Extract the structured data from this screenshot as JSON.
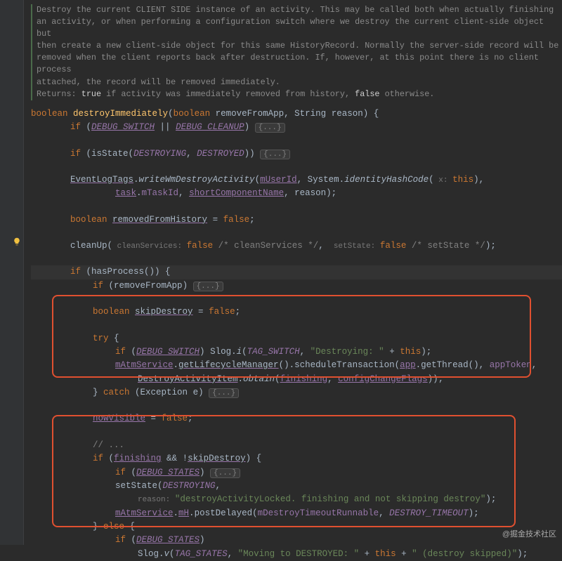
{
  "doc": {
    "l1": "Destroy the current CLIENT SIDE instance of an activity. This may be called both when actually finishing",
    "l2": "an activity, or when performing a configuration switch where we destroy the current client-side object but",
    "l3": "then create a new client-side object for this same HistoryRecord. Normally the server-side record will be",
    "l4": "removed when the client reports back after destruction. If, however, at this point there is no client process",
    "l5": "attached, the record will be removed immediately.",
    "ret_label": "Returns:",
    "ret_true": "true",
    "ret_mid": " if activity was immediately removed from history, ",
    "ret_false": "false",
    "ret_end": " otherwise."
  },
  "sig": {
    "kw_boolean": "boolean",
    "name": "destroyImmediately",
    "p1_type": "boolean",
    "p1_name": "removeFromApp",
    "p2_type": "String",
    "p2_name": "reason",
    "brace": " {"
  },
  "c": {
    "if": "if",
    "else": "else",
    "try": "try",
    "catch": "catch",
    "boolean": "boolean",
    "false": "false",
    "this": "this",
    "debug_switch": "DEBUG_SWITCH",
    "debug_cleanup": "DEBUG_CLEANUP",
    "debug_states": "DEBUG_STATES",
    "fold": "{...}",
    "isState": "isState",
    "destroying": "DESTROYING",
    "destroyed": "DESTROYED",
    "eventLogTags": "EventLogTags",
    "writeWm": "writeWmDestroyActivity",
    "mUserId": "mUserId",
    "System": "System",
    "idHash": "identityHashCode",
    "hint_x": " x: ",
    "task": "task",
    "mTaskId": "mTaskId",
    "shortComp": "shortComponentName",
    "reason": "reason",
    "removedFromHistory": "removedFromHistory",
    "cleanUp": "cleanUp",
    "hint_cleanServices": " cleanServices: ",
    "cm_cleanServices": " /* cleanServices */",
    "hint_setState": " setState: ",
    "cm_setState": " /* setState */",
    "hasProcess": "hasProcess",
    "removeFromApp": "removeFromApp",
    "skipDestroy": "skipDestroy",
    "Slog": "Slog",
    "slog_i": "i",
    "slog_v": "v",
    "tag_switch": "TAG_SWITCH",
    "tag_states": "TAG_STATES",
    "str_destroying": "\"Destroying: \"",
    "plus": " + ",
    "mAtmService": "mAtmService",
    "getLCM": "getLifecycleManager",
    "schedTx": "scheduleTransaction",
    "app": "app",
    "getThread": "getThread",
    "appToken": "appToken",
    "DAI": "DestroyActivityItem",
    "obtain": "obtain",
    "finishing": "finishing",
    "ccFlags": "configChangeFlags",
    "Exception": "Exception",
    "e": "e",
    "nowVisible": "nowVisible",
    "cm_dots": "// ...",
    "bang": "!",
    "and": " && ",
    "setState": "setState",
    "hint_reason": "reason: ",
    "str_reason": "\"destroyActivityLocked. finishing and not skipping destroy\"",
    "mH": "mH",
    "postDelayed": "postDelayed",
    "mDestroyRun": "mDestroyTimeoutRunnable",
    "destroy_timeout": "DESTROY_TIMEOUT",
    "str_moving": "\"Moving to DESTROYED: \"",
    "str_skipped": "\" (destroy skipped)\""
  },
  "watermark": "@掘金技术社区"
}
